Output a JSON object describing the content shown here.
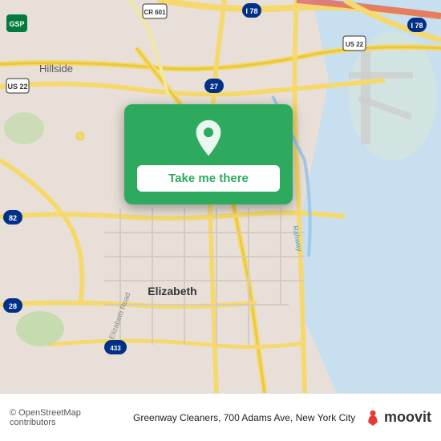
{
  "map": {
    "background_color": "#e8e0d8"
  },
  "popup": {
    "button_label": "Take me there",
    "bg_color": "#2eaa5e",
    "pin_icon": "location-pin-icon"
  },
  "bottom_bar": {
    "copyright": "© OpenStreetMap contributors",
    "location": "Greenway Cleaners, 700 Adams Ave, New York City",
    "brand": "moovit"
  }
}
